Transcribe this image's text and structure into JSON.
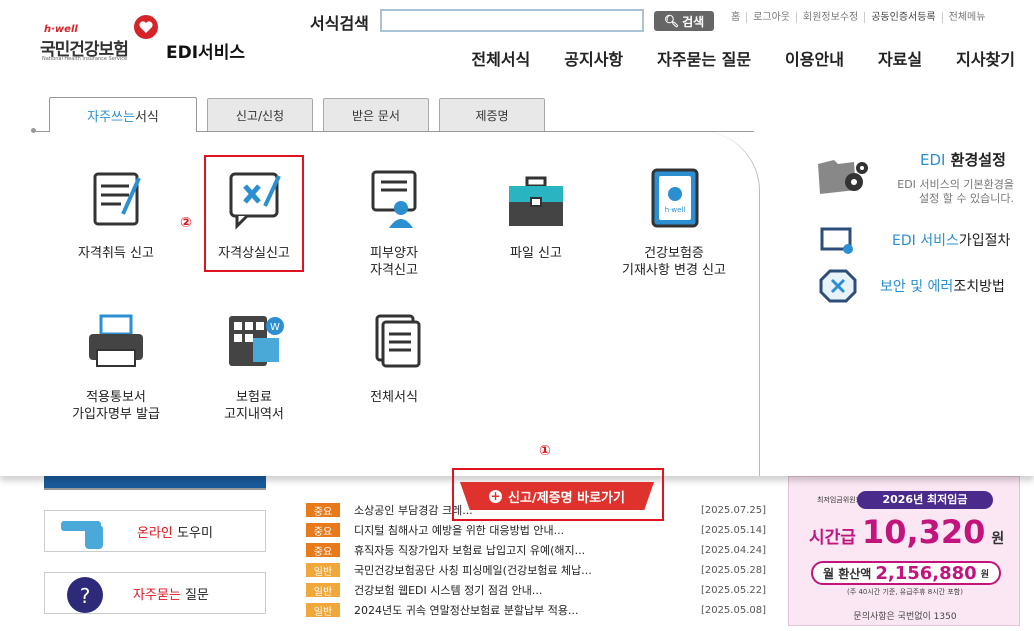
{
  "header": {
    "logo_hwell": "h·well",
    "logo_name": "국민건강보험",
    "logo_en": "National Health Insurance Service",
    "service": "EDI서비스",
    "search_label": "서식검색",
    "search_value": "",
    "search_button": "검색",
    "util_links": [
      "홈",
      "로그아웃",
      "회원정보수정",
      "공동인증서등록",
      "전체메뉴"
    ],
    "nav": [
      "전체서식",
      "공지사항",
      "자주묻는 질문",
      "이용안내",
      "자료실",
      "지사찾기"
    ]
  },
  "tabs": {
    "active_prefix": "자주쓰는",
    "active_suffix": " 서식",
    "others": [
      "신고/신청",
      "받은 문서",
      "제증명"
    ]
  },
  "items": [
    {
      "label": "자격취득 신고",
      "icon": "document-pen-icon"
    },
    {
      "label": "자격상실신고",
      "icon": "document-x-icon"
    },
    {
      "label1": "피부양자",
      "label2": "자격신고",
      "icon": "person-document-icon"
    },
    {
      "label": "파일 신고",
      "icon": "briefcase-icon"
    },
    {
      "label1": "건강보험증",
      "label2": "기재사항 변경 신고",
      "icon": "health-card-icon"
    },
    {
      "label1": "적용통보서",
      "label2": "가입자명부 발급",
      "icon": "printer-icon"
    },
    {
      "label1": "보험료",
      "label2": "고지내역서",
      "icon": "calculator-icon"
    },
    {
      "label": "전체서식",
      "icon": "stacked-documents-icon"
    }
  ],
  "annotations": {
    "one": "①",
    "two": "②"
  },
  "side": {
    "env_title_a": "EDI",
    "env_title_b": " 환경설정",
    "env_desc1": "EDI 서비스의 기본환경을",
    "env_desc2": "설정 할 수 있습니다.",
    "join_a": "EDI 서비스",
    "join_b": " 가입절차",
    "sec_a": "보안 및 에러",
    "sec_b": " 조치방법"
  },
  "bottom": {
    "online_a": "온라인",
    "online_b": " 도우미",
    "faq_a": "자주묻는",
    "faq_b": " 질문",
    "shortcut": "신고/제증명 바로가기",
    "news": [
      {
        "tag": "중요",
        "type": "imp",
        "text": "소상공인 부담경감 크레...",
        "date": "[2025.07.25]"
      },
      {
        "tag": "중요",
        "type": "imp",
        "text": "디지털 침해사고 예방을 위한 대응방법 안내...",
        "date": "[2025.05.14]"
      },
      {
        "tag": "중요",
        "type": "imp",
        "text": "휴직자등 직장가입자 보험료 납입고지 유예(해지...",
        "date": "[2025.04.24]"
      },
      {
        "tag": "일반",
        "type": "gen",
        "text": "국민건강보험공단 사칭 피싱메일(건강보험료 체납...",
        "date": "[2025.05.28]"
      },
      {
        "tag": "일반",
        "type": "gen",
        "text": "건강보험 웹EDI 시스템 정기 점검 안내...",
        "date": "[2025.05.22]"
      },
      {
        "tag": "일반",
        "type": "gen",
        "text": "2024년도 귀속 연말정산보험료 분할납부 적용...",
        "date": "[2025.05.08]"
      }
    ],
    "banner": {
      "org": "최저임금위원회",
      "title": "2026년 최저임금",
      "hourly_label": "시간급",
      "hourly_value": "10,320",
      "hourly_unit": "원",
      "monthly_label": "월 환산액",
      "monthly_value": "2,156,880",
      "monthly_unit": "원",
      "note": "(주 40시간 기준, 유급주휴 8시간 포함)",
      "contact": "문의사항은 국번없이 1350"
    }
  }
}
